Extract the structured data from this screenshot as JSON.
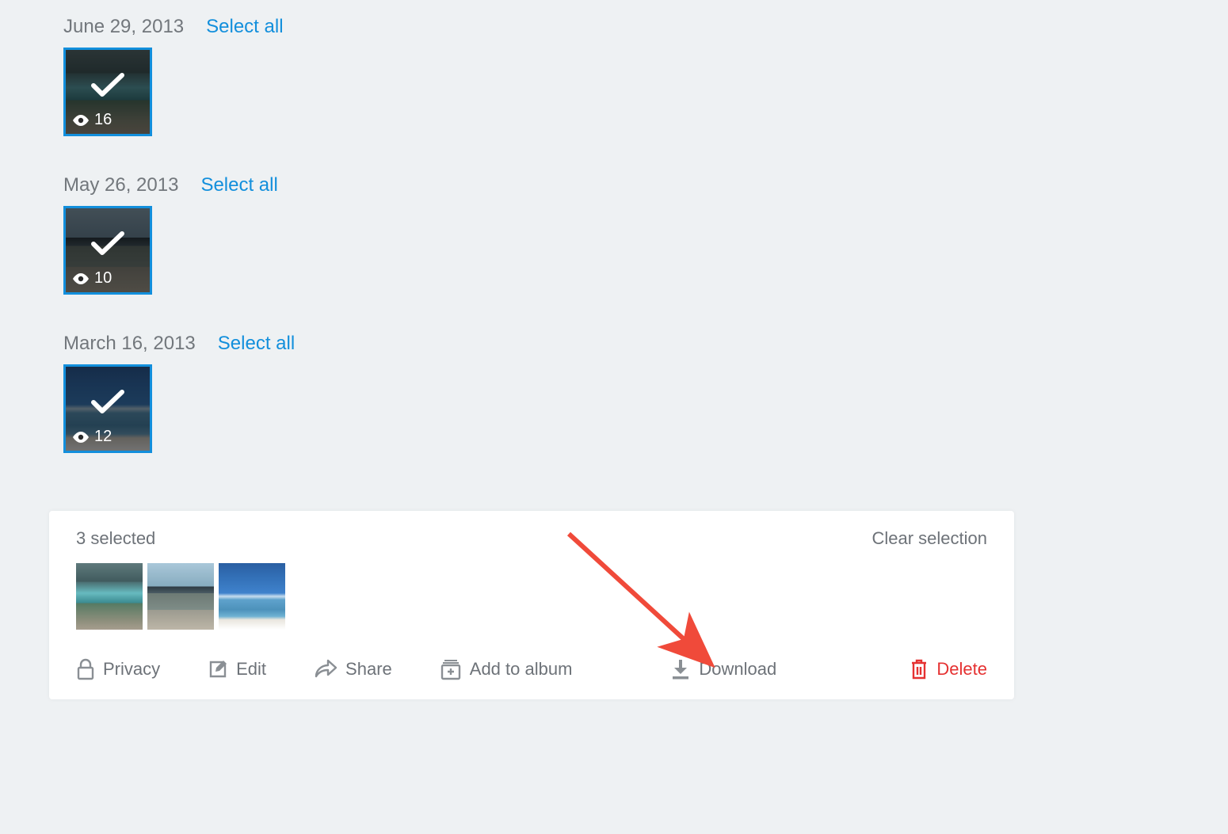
{
  "groups": [
    {
      "date": "June 29, 2013",
      "select_all": "Select all",
      "views": "16"
    },
    {
      "date": "May 26, 2013",
      "select_all": "Select all",
      "views": "10"
    },
    {
      "date": "March 16, 2013",
      "select_all": "Select all",
      "views": "12"
    }
  ],
  "panel": {
    "selected_text": "3 selected",
    "clear_text": "Clear selection",
    "actions": {
      "privacy": "Privacy",
      "edit": "Edit",
      "share": "Share",
      "add_to_album": "Add to album",
      "download": "Download",
      "delete": "Delete"
    }
  }
}
